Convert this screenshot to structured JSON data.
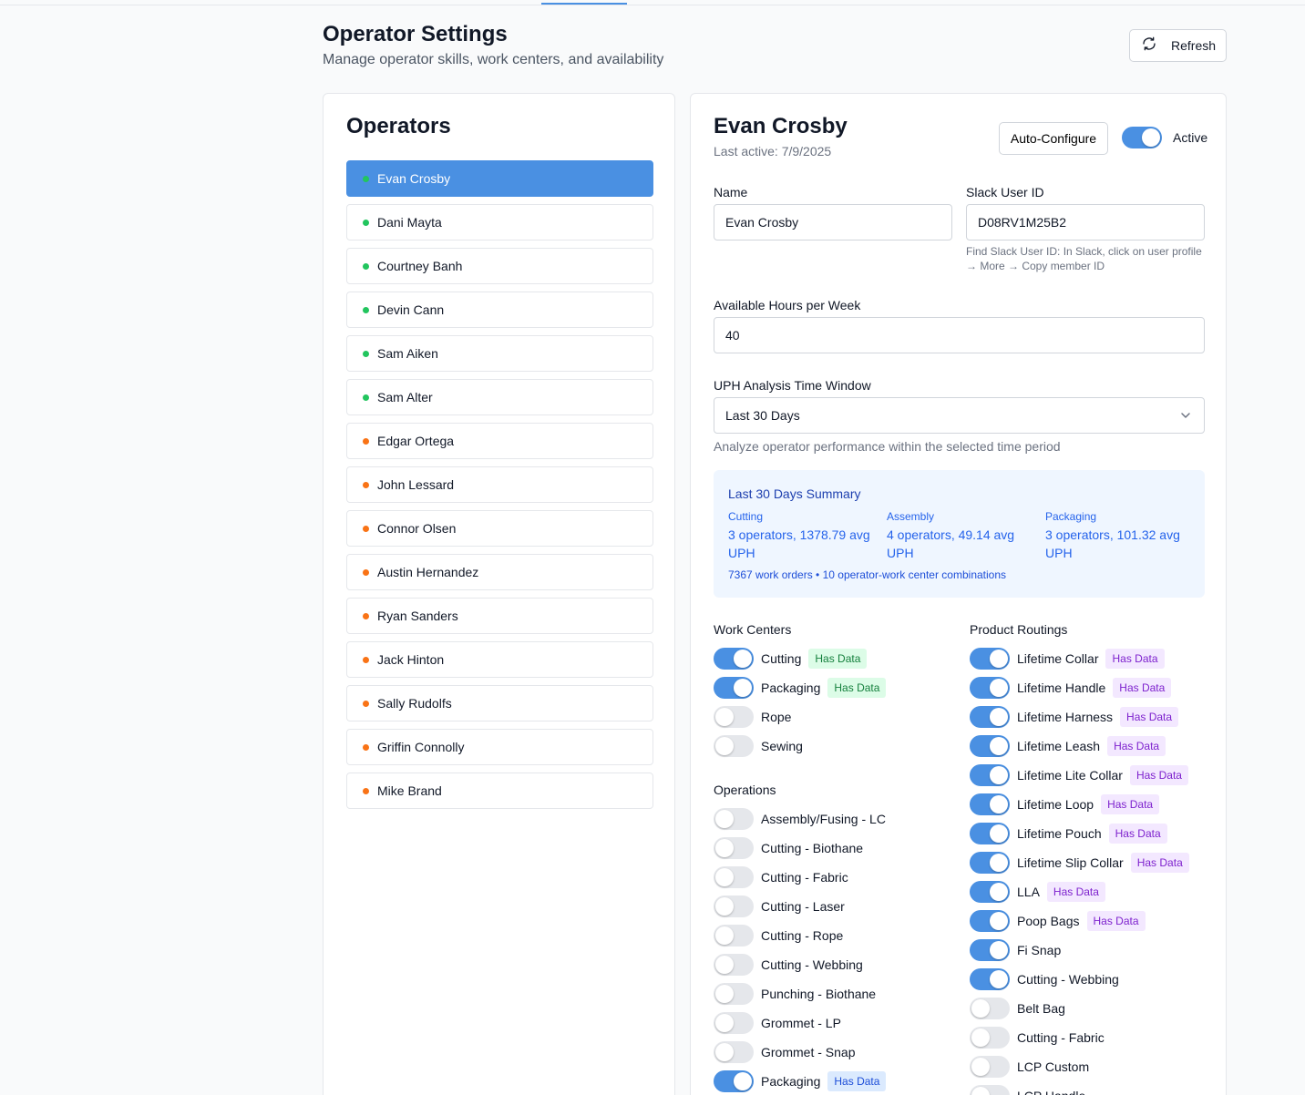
{
  "header": {
    "title": "Operator Settings",
    "subtitle": "Manage operator skills, work centers, and availability",
    "refresh_label": "Refresh"
  },
  "colors": {
    "accent": "#4a90e2",
    "online": "#22c55e",
    "away": "#f97316"
  },
  "operators": {
    "title": "Operators",
    "selected": "Evan Crosby",
    "items": [
      {
        "name": "Evan Crosby",
        "status": "online"
      },
      {
        "name": "Dani Mayta",
        "status": "online"
      },
      {
        "name": "Courtney Banh",
        "status": "online"
      },
      {
        "name": "Devin Cann",
        "status": "online"
      },
      {
        "name": "Sam Aiken",
        "status": "online"
      },
      {
        "name": "Sam Alter",
        "status": "online"
      },
      {
        "name": "Edgar Ortega",
        "status": "away"
      },
      {
        "name": "John Lessard",
        "status": "away"
      },
      {
        "name": "Connor Olsen",
        "status": "away"
      },
      {
        "name": "Austin Hernandez",
        "status": "away"
      },
      {
        "name": "Ryan Sanders",
        "status": "away"
      },
      {
        "name": "Jack Hinton",
        "status": "away"
      },
      {
        "name": "Sally Rudolfs",
        "status": "away"
      },
      {
        "name": "Griffin Connolly",
        "status": "away"
      },
      {
        "name": "Mike Brand",
        "status": "away"
      }
    ]
  },
  "detail": {
    "name": "Evan Crosby",
    "last_active": "Last active: 7/9/2025",
    "auto_configure_label": "Auto-Configure",
    "active_label": "Active",
    "active": true,
    "fields": {
      "name_label": "Name",
      "name_value": "Evan Crosby",
      "slack_label": "Slack User ID",
      "slack_value": "D08RV1M25B2",
      "slack_help_1": "Find Slack User ID: In Slack, click on user profile",
      "slack_help_2": "→ More → Copy member ID",
      "hours_label": "Available Hours per Week",
      "hours_value": "40",
      "uph_label": "UPH Analysis Time Window",
      "uph_value": "Last 30 Days",
      "uph_help": "Analyze operator performance within the selected time period"
    },
    "summary": {
      "title": "Last 30 Days Summary",
      "columns": [
        {
          "name": "Cutting",
          "value": "3 operators, 1378.79 avg UPH"
        },
        {
          "name": "Assembly",
          "value": "4 operators, 49.14 avg UPH"
        },
        {
          "name": "Packaging",
          "value": "3 operators, 101.32 avg UPH"
        }
      ],
      "footer": "7367 work orders • 10 operator-work center combinations"
    },
    "work_centers": {
      "title": "Work Centers",
      "items": [
        {
          "label": "Cutting",
          "on": true,
          "badge": "Has Data"
        },
        {
          "label": "Packaging",
          "on": true,
          "badge": "Has Data"
        },
        {
          "label": "Rope",
          "on": false,
          "badge": ""
        },
        {
          "label": "Sewing",
          "on": false,
          "badge": ""
        }
      ]
    },
    "operations": {
      "title": "Operations",
      "items": [
        {
          "label": "Assembly/Fusing - LC",
          "on": false,
          "badge": ""
        },
        {
          "label": "Cutting - Biothane",
          "on": false,
          "badge": ""
        },
        {
          "label": "Cutting - Fabric",
          "on": false,
          "badge": ""
        },
        {
          "label": "Cutting - Laser",
          "on": false,
          "badge": ""
        },
        {
          "label": "Cutting - Rope",
          "on": false,
          "badge": ""
        },
        {
          "label": "Cutting - Webbing",
          "on": false,
          "badge": ""
        },
        {
          "label": "Punching - Biothane",
          "on": false,
          "badge": ""
        },
        {
          "label": "Grommet - LP",
          "on": false,
          "badge": ""
        },
        {
          "label": "Grommet - Snap",
          "on": false,
          "badge": ""
        },
        {
          "label": "Packaging",
          "on": true,
          "badge": "Has Data"
        }
      ]
    },
    "product_routings": {
      "title": "Product Routings",
      "items": [
        {
          "label": "Lifetime Collar",
          "on": true,
          "badge": "Has Data"
        },
        {
          "label": "Lifetime Handle",
          "on": true,
          "badge": "Has Data"
        },
        {
          "label": "Lifetime Harness",
          "on": true,
          "badge": "Has Data"
        },
        {
          "label": "Lifetime Leash",
          "on": true,
          "badge": "Has Data"
        },
        {
          "label": "Lifetime Lite Collar",
          "on": true,
          "badge": "Has Data"
        },
        {
          "label": "Lifetime Loop",
          "on": true,
          "badge": "Has Data"
        },
        {
          "label": "Lifetime Pouch",
          "on": true,
          "badge": "Has Data"
        },
        {
          "label": "Lifetime Slip Collar",
          "on": true,
          "badge": "Has Data"
        },
        {
          "label": "LLA",
          "on": true,
          "badge": "Has Data"
        },
        {
          "label": "Poop Bags",
          "on": true,
          "badge": "Has Data"
        },
        {
          "label": "Fi Snap",
          "on": true,
          "badge": ""
        },
        {
          "label": "Cutting - Webbing",
          "on": true,
          "badge": ""
        },
        {
          "label": "Belt Bag",
          "on": false,
          "badge": ""
        },
        {
          "label": "Cutting - Fabric",
          "on": false,
          "badge": ""
        },
        {
          "label": "LCP Custom",
          "on": false,
          "badge": ""
        },
        {
          "label": "LCP Handle",
          "on": false,
          "badge": ""
        }
      ]
    }
  }
}
